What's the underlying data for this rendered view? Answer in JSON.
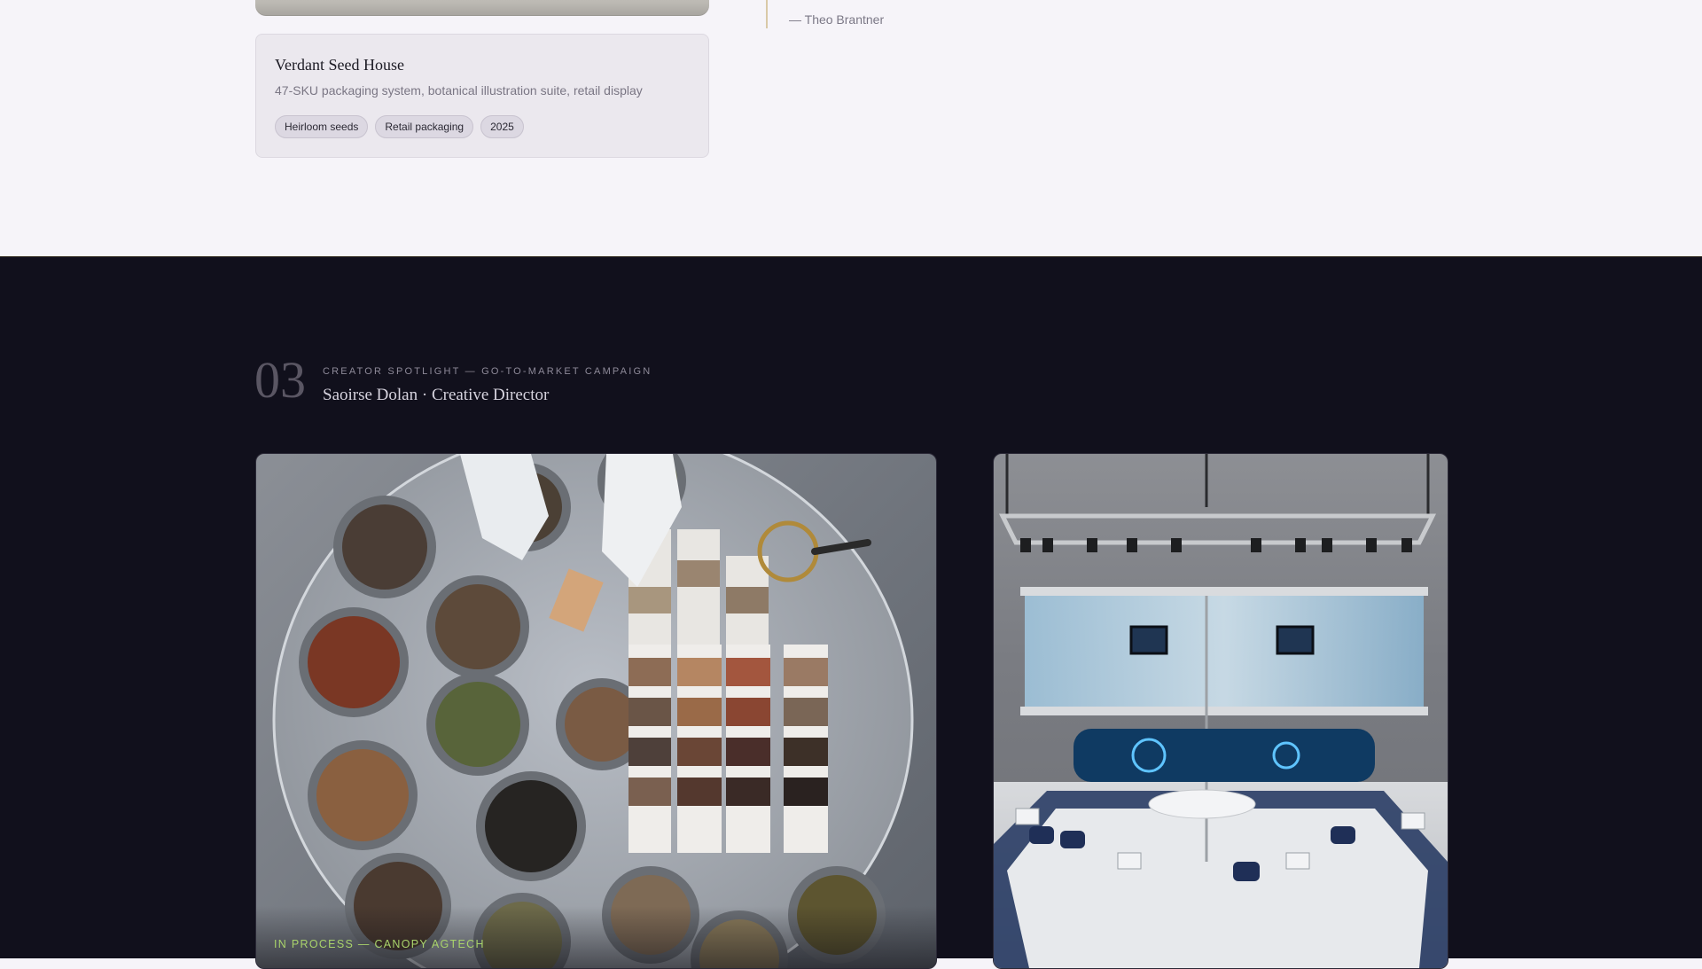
{
  "previous_project": {
    "title": "Verdant Seed House",
    "description": "47-SKU packaging system, botanical illustration suite, retail display",
    "tags": [
      "Heirloom seeds",
      "Retail packaging",
      "2025"
    ]
  },
  "testimonial": {
    "author": "— Theo Brantner"
  },
  "spotlight": {
    "number": "03",
    "kicker": "CREATOR SPOTLIGHT — GO-TO-MARKET CAMPAIGN",
    "title": "Saoirse Dolan · Creative Director"
  },
  "gallery": {
    "main_caption": "IN PROCESS — CANOPY AGTECH"
  },
  "colors": {
    "light_bg": "#f6f4f9",
    "dark_bg": "#11101c",
    "caption_accent": "#a9d36b"
  }
}
